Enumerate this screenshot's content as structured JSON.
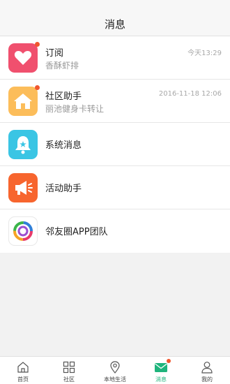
{
  "header": {
    "title": "消息"
  },
  "messages": [
    {
      "title": "订阅",
      "subtitle": "香酥虾排",
      "time": "今天13:29",
      "icon": "heart-icon",
      "color": "#f0506e",
      "unread": true
    },
    {
      "title": "社区助手",
      "subtitle": "丽池健身卡转让",
      "time": "2016-11-18 12:06",
      "icon": "home-icon",
      "color": "#fcbd5a",
      "unread": true
    },
    {
      "title": "系统消息",
      "icon": "bell-icon",
      "color": "#3ac5e4",
      "unread": false
    },
    {
      "title": "活动助手",
      "icon": "megaphone-icon",
      "color": "#f7652e",
      "unread": false
    },
    {
      "title": "邻友圈APP团队",
      "icon": "app-logo-icon",
      "color": "#ffffff",
      "unread": false
    }
  ],
  "tabbar": {
    "items": [
      {
        "label": "首页",
        "icon": "home-outline-icon"
      },
      {
        "label": "社区",
        "icon": "grid-icon"
      },
      {
        "label": "本地生活",
        "icon": "location-pin-icon"
      },
      {
        "label": "消息",
        "icon": "mail-icon",
        "active": true,
        "unread": true
      },
      {
        "label": "我的",
        "icon": "person-icon"
      }
    ],
    "active_color": "#1fb47c"
  }
}
